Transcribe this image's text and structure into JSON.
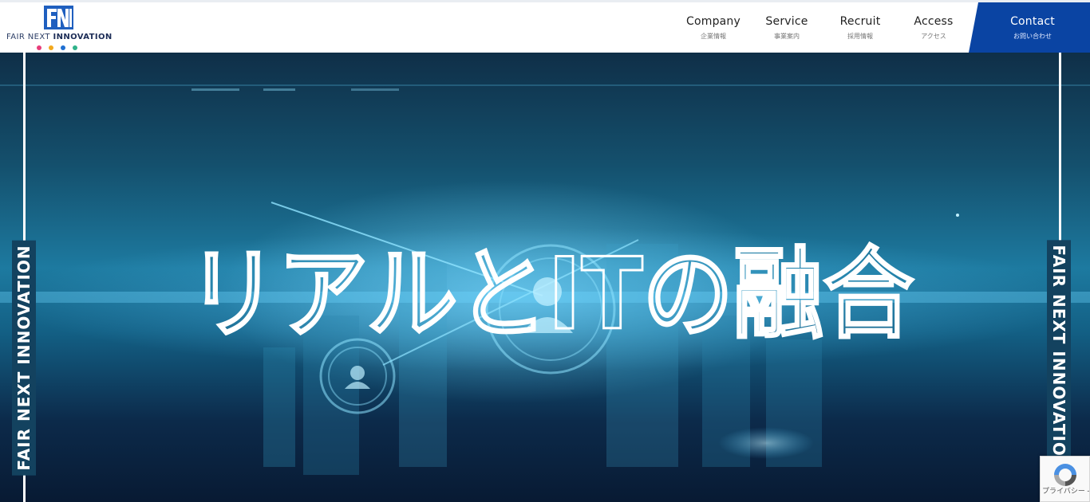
{
  "logo": {
    "mark": "FNI",
    "text_regular": "FAIR NEXT ",
    "text_bold": "INNOVATION",
    "dot_colors": [
      "#e83d7a",
      "#f2a81d",
      "#1f6fd1",
      "#2fb28a"
    ]
  },
  "nav": {
    "items": [
      {
        "en": "Company",
        "jp": "企業情報"
      },
      {
        "en": "Service",
        "jp": "事業案内"
      },
      {
        "en": "Recruit",
        "jp": "採用情報"
      },
      {
        "en": "Access",
        "jp": "アクセス"
      }
    ],
    "contact": {
      "en": "Contact",
      "jp": "お問い合わせ"
    }
  },
  "hero": {
    "headline": "リアルとITの融合",
    "side_label": "FAIR NEXT INNOVATION"
  },
  "recaptcha": {
    "text": "プライバシー - 利用規約"
  },
  "colors": {
    "brand": "#0a44a3",
    "hero_accent": "#4fc3f7"
  }
}
